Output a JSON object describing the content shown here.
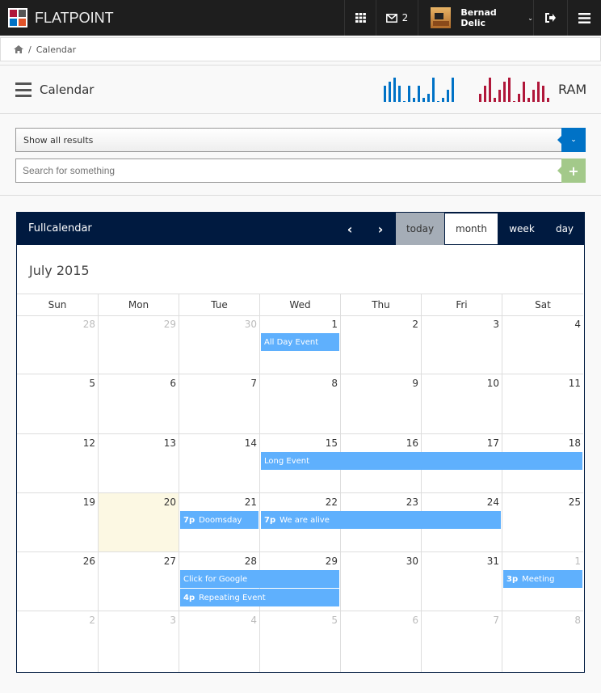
{
  "topbar": {
    "brand": "FLATPOINT",
    "logo_colors": [
      "#b0173a",
      "#555555",
      "#0072c6",
      "#e0542a"
    ],
    "grid_icon": "grid-icon",
    "mail_icon": "envelope-icon",
    "mail_count": "2",
    "user_name": "Bernad Delic",
    "logout_icon": "sign-out-icon",
    "menu_icon": "hamburger-icon"
  },
  "breadcrumb": {
    "home_icon": "home-icon",
    "separator": "/",
    "current": "Calendar"
  },
  "page_header": {
    "title": "Calendar",
    "ram_label": "RAM",
    "sparkline_blue": {
      "color": "#0072c6",
      "values": [
        4,
        5,
        6,
        4,
        0,
        4,
        1,
        4,
        1,
        2,
        6,
        0,
        1,
        3,
        6
      ]
    },
    "sparkline_red": {
      "color": "#b0173a",
      "values": [
        2,
        4,
        6,
        1,
        3,
        5,
        6,
        0,
        2,
        5,
        1,
        3,
        5,
        4,
        1
      ]
    }
  },
  "filter": {
    "selected": "Show all results",
    "button_color": "#0072c6"
  },
  "search": {
    "placeholder": "Search for something",
    "add_color": "#a3c98a"
  },
  "calendar": {
    "panel_title": "Fullcalendar",
    "header_color": "#001a40",
    "buttons": {
      "today": "today",
      "month": "month",
      "week": "week",
      "day": "day"
    },
    "active_view": "month",
    "month_title": "July 2015",
    "weekdays": [
      "Sun",
      "Mon",
      "Tue",
      "Wed",
      "Thu",
      "Fri",
      "Sat"
    ],
    "today": 20,
    "weeks": [
      [
        [
          28,
          true
        ],
        [
          29,
          true
        ],
        [
          30,
          true
        ],
        [
          1,
          false
        ],
        [
          2,
          false
        ],
        [
          3,
          false
        ],
        [
          4,
          false
        ]
      ],
      [
        [
          5,
          false
        ],
        [
          6,
          false
        ],
        [
          7,
          false
        ],
        [
          8,
          false
        ],
        [
          9,
          false
        ],
        [
          10,
          false
        ],
        [
          11,
          false
        ]
      ],
      [
        [
          12,
          false
        ],
        [
          13,
          false
        ],
        [
          14,
          false
        ],
        [
          15,
          false
        ],
        [
          16,
          false
        ],
        [
          17,
          false
        ],
        [
          18,
          false
        ]
      ],
      [
        [
          19,
          false
        ],
        [
          20,
          false
        ],
        [
          21,
          false
        ],
        [
          22,
          false
        ],
        [
          23,
          false
        ],
        [
          24,
          false
        ],
        [
          25,
          false
        ]
      ],
      [
        [
          26,
          false
        ],
        [
          27,
          false
        ],
        [
          28,
          false
        ],
        [
          29,
          false
        ],
        [
          30,
          false
        ],
        [
          31,
          false
        ],
        [
          1,
          true
        ]
      ],
      [
        [
          2,
          true
        ],
        [
          3,
          true
        ],
        [
          4,
          true
        ],
        [
          5,
          true
        ],
        [
          6,
          true
        ],
        [
          7,
          true
        ],
        [
          8,
          true
        ]
      ]
    ],
    "event_color": "#5fb0fd",
    "events": [
      {
        "title": "All Day Event",
        "time": "",
        "week": 0,
        "start": 3,
        "end": 3,
        "slot": 0
      },
      {
        "title": "Long Event",
        "time": "",
        "week": 2,
        "start": 3,
        "end": 6,
        "slot": 0
      },
      {
        "title": "Doomsday",
        "time": "7p",
        "week": 3,
        "start": 2,
        "end": 2,
        "slot": 0
      },
      {
        "title": "We are alive",
        "time": "7p",
        "week": 3,
        "start": 3,
        "end": 5,
        "slot": 0
      },
      {
        "title": "Click for Google",
        "time": "",
        "week": 4,
        "start": 2,
        "end": 3,
        "slot": 0
      },
      {
        "title": "Repeating Event",
        "time": "4p",
        "week": 4,
        "start": 2,
        "end": 3,
        "slot": 1
      },
      {
        "title": "Meeting",
        "time": "3p",
        "week": 4,
        "start": 6,
        "end": 6,
        "slot": 0
      }
    ]
  }
}
